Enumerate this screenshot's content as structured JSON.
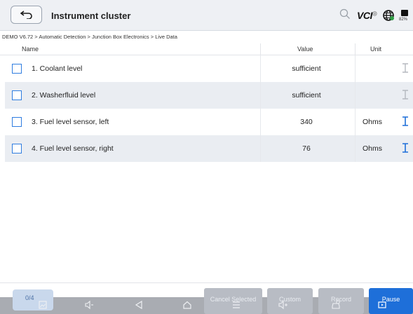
{
  "header": {
    "title": "Instrument cluster",
    "vci_label": "VCI",
    "battery_percent": "82%"
  },
  "breadcrumb": "DEMO V6.72 > Automatic Detection  > Junction Box Electronics > Live Data",
  "columns": {
    "name": "Name",
    "value": "Value",
    "unit": "Unit"
  },
  "rows": [
    {
      "name": "1. Coolant level",
      "value": "sufficient",
      "unit": "",
      "graph_active": false
    },
    {
      "name": "2. Washerfluid level",
      "value": "sufficient",
      "unit": "",
      "graph_active": false
    },
    {
      "name": "3. Fuel level sensor, left",
      "value": "340",
      "unit": "Ohms",
      "graph_active": true
    },
    {
      "name": "4. Fuel level sensor, right",
      "value": "76",
      "unit": "Ohms",
      "graph_active": true
    }
  ],
  "footer": {
    "counter": "0/4",
    "cancel_selected": "Cancel Selected",
    "custom": "Custom",
    "record": "Record",
    "pause": "Pause"
  },
  "colors": {
    "accent": "#1e6fd9",
    "header_bg": "#eef0f4",
    "row_alt": "#eaedf2",
    "navbar": "#a9acb2"
  }
}
